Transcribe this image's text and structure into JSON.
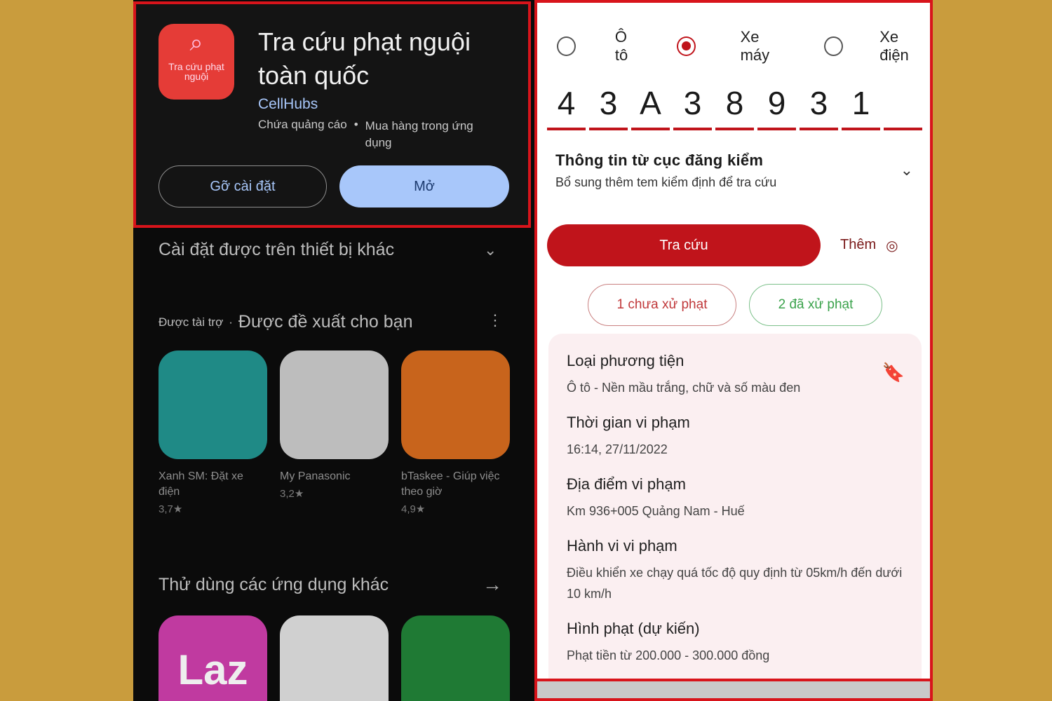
{
  "store": {
    "app_icon_text": "Tra cứu phạt nguội",
    "app_title": "Tra cứu phạt nguội toàn quốc",
    "developer": "CellHubs",
    "meta": [
      "Chứa quảng cáo",
      "Mua hàng trong ứng dụng"
    ],
    "uninstall_label": "Gỡ cài đặt",
    "open_label": "Mở",
    "other_devices": "Cài đặt được trên thiết bị khác",
    "sponsored": "Được tài trợ",
    "suggested": "Được đề xuất cho bạn",
    "apps": [
      {
        "name": "Xanh SM: Đặt xe điện",
        "rating": "3,7★",
        "color": "#1f8a86"
      },
      {
        "name": "My Panasonic",
        "rating": "3,2★",
        "color": "#bdbdbd"
      },
      {
        "name": "bTaskee - Giúp việc theo giờ",
        "rating": "4,9★",
        "color": "#c8641c"
      }
    ],
    "try_other": "Thử dùng các ứng dụng khác",
    "apps2": [
      {
        "label": "Laz",
        "color": "#c03aa0"
      },
      {
        "label": "",
        "color": "#d0d0d0"
      },
      {
        "label": "",
        "color": "#1f7a34"
      }
    ]
  },
  "lookup": {
    "vehicle_types": [
      {
        "label": "Ô tô",
        "selected": false
      },
      {
        "label": "Xe máy",
        "selected": true
      },
      {
        "label": "Xe điện",
        "selected": false
      }
    ],
    "plate": [
      "4",
      "3",
      "A",
      "3",
      "8",
      "9",
      "3",
      "1",
      ""
    ],
    "info_title": "Thông tin từ cục đăng kiểm",
    "info_sub": "Bổ sung thêm tem kiểm định để tra cứu",
    "search_label": "Tra cứu",
    "more_label": "Thêm",
    "unpaid": "1 chưa xử phạt",
    "paid": "2 đã xử phạt",
    "details": [
      {
        "k": "Loại phương tiện",
        "v": "Ô tô - Nền mầu trắng, chữ và số màu đen"
      },
      {
        "k": "Thời gian vi phạm",
        "v": "16:14, 27/11/2022"
      },
      {
        "k": "Địa điểm vi phạm",
        "v": "Km 936+005 Quảng Nam - Huế"
      },
      {
        "k": "Hành vi vi phạm",
        "v": "Điều khiển xe chạy quá tốc độ quy định từ 05km/h đến dưới 10 km/h"
      },
      {
        "k": "Hình phạt (dự kiến)",
        "v": "Phạt tiền từ 200.000 - 300.000 đồng"
      }
    ],
    "accent": "#c0141b"
  }
}
